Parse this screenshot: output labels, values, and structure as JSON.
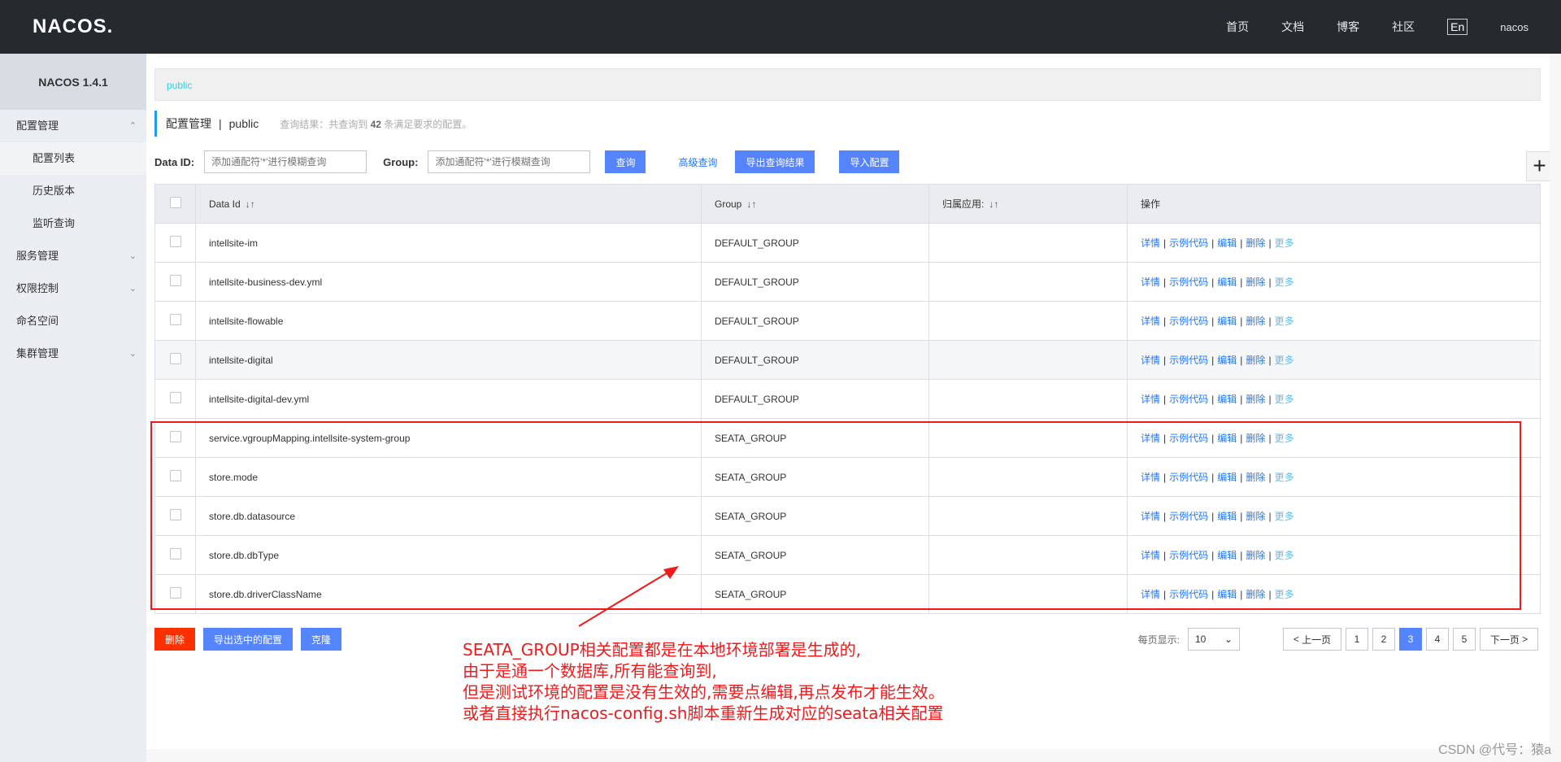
{
  "header": {
    "logo": "NACOS.",
    "nav": [
      "首页",
      "文档",
      "博客",
      "社区"
    ],
    "lang": "En",
    "user": "nacos"
  },
  "sidebar": {
    "title": "NACOS 1.4.1",
    "items": [
      {
        "label": "配置管理",
        "arrow": "chevron-up-icon"
      },
      {
        "label": "配置列表",
        "sub": true,
        "active": true
      },
      {
        "label": "历史版本",
        "sub": true
      },
      {
        "label": "监听查询",
        "sub": true
      },
      {
        "label": "服务管理",
        "arrow": "chevron-down-icon"
      },
      {
        "label": "权限控制",
        "arrow": "chevron-down-icon"
      },
      {
        "label": "命名空间"
      },
      {
        "label": "集群管理",
        "arrow": "chevron-down-icon"
      }
    ]
  },
  "namespace_tab": "public",
  "page": {
    "title": "配置管理",
    "namespace": "public",
    "hint_prefix": "查询结果：共查询到",
    "hint_count": "42",
    "hint_suffix": "条满足要求的配置。"
  },
  "filters": {
    "dataid_label": "Data ID:",
    "dataid_placeholder": "添加通配符'*'进行模糊查询",
    "group_label": "Group:",
    "group_placeholder": "添加通配符'*'进行模糊查询",
    "query": "查询",
    "advanced": "高级查询",
    "export": "导出查询结果",
    "import": "导入配置"
  },
  "table": {
    "headers": [
      "Data Id",
      "Group",
      "归属应用:",
      "操作"
    ],
    "ops": [
      "详情",
      "示例代码",
      "编辑",
      "删除",
      "更多"
    ],
    "rows": [
      {
        "dataid": "intellsite-im",
        "group": "DEFAULT_GROUP"
      },
      {
        "dataid": "intellsite-business-dev.yml",
        "group": "DEFAULT_GROUP"
      },
      {
        "dataid": "intellsite-flowable",
        "group": "DEFAULT_GROUP"
      },
      {
        "dataid": "intellsite-digital",
        "group": "DEFAULT_GROUP"
      },
      {
        "dataid": "intellsite-digital-dev.yml",
        "group": "DEFAULT_GROUP"
      },
      {
        "dataid": "service.vgroupMapping.intellsite-system-group",
        "group": "SEATA_GROUP"
      },
      {
        "dataid": "store.mode",
        "group": "SEATA_GROUP"
      },
      {
        "dataid": "store.db.datasource",
        "group": "SEATA_GROUP"
      },
      {
        "dataid": "store.db.dbType",
        "group": "SEATA_GROUP"
      },
      {
        "dataid": "store.db.driverClassName",
        "group": "SEATA_GROUP"
      }
    ]
  },
  "bottom": {
    "delete": "删除",
    "export_selected": "导出选中的配置",
    "clone": "克隆"
  },
  "pager": {
    "per_page_label": "每页显示:",
    "per_page": "10",
    "prev": "上一页",
    "next": "下一页",
    "pages": [
      "1",
      "2",
      "3",
      "4",
      "5"
    ],
    "current": "3"
  },
  "annotation": [
    "SEATA_GROUP相关配置都是在本地环境部署是生成的,",
    "由于是通一个数据库,所有能查询到,",
    "但是测试环境的配置是没有生效的,需要点编辑,再点发布才能生效。",
    "或者直接执行nacos-config.sh脚本重新生成对应的seata相关配置"
  ],
  "watermark": "CSDN @代号：猿a",
  "colors": {
    "annotation": "#f01a1a",
    "primary": "#5584ff",
    "danger": "#ff3000"
  }
}
